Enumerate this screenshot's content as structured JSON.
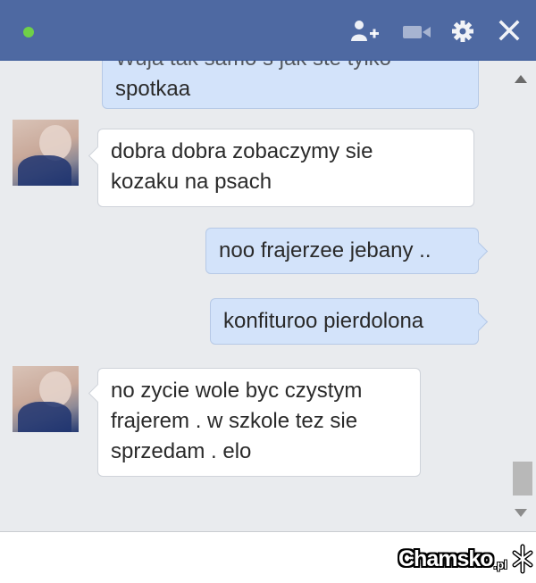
{
  "header": {
    "status": "online",
    "icons": [
      "add-friend-icon",
      "video-call-icon",
      "gear-icon",
      "close-icon"
    ],
    "colors": {
      "bar": "#4e69a2",
      "status": "#6fd048"
    }
  },
  "messages": [
    {
      "direction": "out",
      "lines": [
        "Wuja tak samo s jak ste tylko",
        "spotkaa"
      ]
    },
    {
      "direction": "in",
      "lines": [
        "dobra dobra zobaczymy sie",
        "kozaku na psach"
      ]
    },
    {
      "direction": "out",
      "lines": [
        "noo frajerzee jebany .."
      ]
    },
    {
      "direction": "out",
      "lines": [
        "konfituroo  pierdolona"
      ]
    },
    {
      "direction": "in",
      "lines": [
        "no zycie wole byc czystym",
        "frajerem . w szkole tez sie",
        "sprzedam . elo"
      ]
    }
  ],
  "watermark": {
    "text": "Chamsko",
    "suffix": ".pl"
  },
  "colors": {
    "outgoing": "#d3e3fa",
    "incoming": "#ffffff",
    "background": "#e9ebee"
  }
}
